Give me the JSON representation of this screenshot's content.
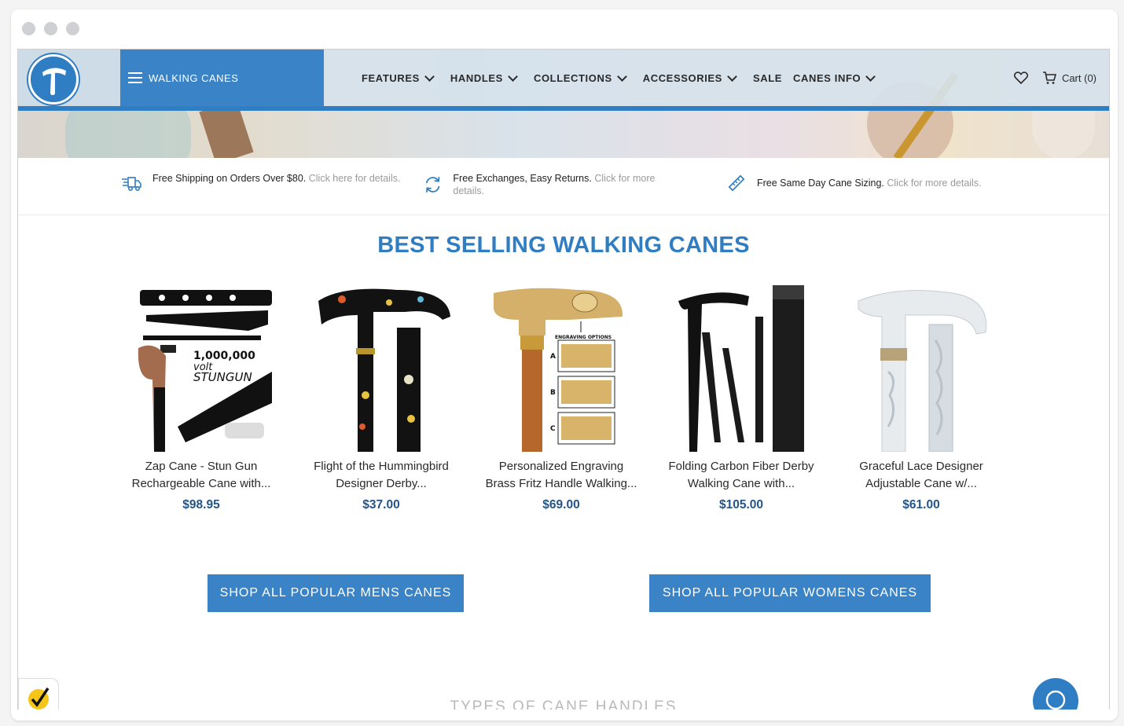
{
  "nav": {
    "category_label": "WALKING CANES",
    "menu": [
      {
        "label": "FEATURES",
        "has_dropdown": true
      },
      {
        "label": "HANDLES",
        "has_dropdown": true
      },
      {
        "label": "COLLECTIONS",
        "has_dropdown": true
      },
      {
        "label": "ACCESSORIES",
        "has_dropdown": true
      },
      {
        "label": "SALE",
        "has_dropdown": false
      },
      {
        "label": "CANES INFO",
        "has_dropdown": true
      }
    ],
    "cart_label": "Cart (0)",
    "accent_color": "#2f7dc2"
  },
  "benefits": [
    {
      "icon": "delivery-truck-icon",
      "main": "Free Shipping on Orders Over $80.",
      "sub": "Click here for details."
    },
    {
      "icon": "exchange-arrows-icon",
      "main": "Free Exchanges, Easy Returns.",
      "sub": "Click for more details."
    },
    {
      "icon": "ruler-icon",
      "main": "Free Same Day Cane Sizing.",
      "sub": "Click for more details."
    }
  ],
  "best_selling": {
    "title": "BEST SELLING WALKING CANES",
    "products": [
      {
        "name_line1": "Zap Cane - Stun Gun",
        "name_line2": "Rechargeable Cane with...",
        "price": "$98.95",
        "image_text": [
          "1,000,000",
          "volt",
          "STUNGUN"
        ]
      },
      {
        "name_line1": "Flight of the Hummingbird",
        "name_line2": "Designer Derby...",
        "price": "$37.00"
      },
      {
        "name_line1": "Personalized Engraving",
        "name_line2": "Brass Fritz Handle Walking...",
        "price": "$69.00",
        "image_text": [
          "ENGRAVING OPTIONS",
          "A",
          "B",
          "C"
        ]
      },
      {
        "name_line1": "Folding Carbon Fiber Derby",
        "name_line2": "Walking Cane with...",
        "price": "$105.00"
      },
      {
        "name_line1": "Graceful Lace Designer",
        "name_line2": "Adjustable Cane w/...",
        "price": "$61.00"
      }
    ]
  },
  "buttons": {
    "mens": "SHOP ALL POPULAR MENS CANES",
    "womens": "SHOP ALL POPULAR WOMENS CANES"
  },
  "types_title": "TYPES OF CANE HANDLES"
}
